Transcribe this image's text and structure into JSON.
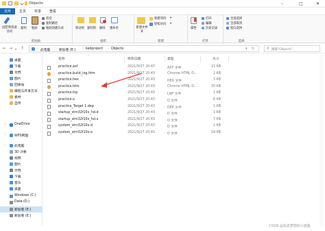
{
  "window": {
    "title": "Objects",
    "controls": {
      "minimize": "–",
      "maximize": "□",
      "close": "✕"
    }
  },
  "tabs": [
    "文件",
    "主页",
    "共享",
    "查看"
  ],
  "ribbon": {
    "clipboard": {
      "label": "剪贴板",
      "pin": "固定到快速访问",
      "copy": "复制",
      "paste": "粘贴",
      "cut": "剪切",
      "copy_path": "复制路径",
      "paste_shortcut": "粘贴快捷方式"
    },
    "organize": {
      "label": "组织",
      "move_to": "移动到",
      "copy_to": "复制到",
      "delete": "删除",
      "rename": "重命名"
    },
    "new": {
      "label": "新建",
      "new_item": "新建项目",
      "easy_access": "轻松访问",
      "new_folder": "新建文件夹"
    },
    "open": {
      "label": "打开",
      "properties": "属性",
      "open": "打开",
      "edit": "编辑",
      "history": "历史记录"
    },
    "select": {
      "label": "选择",
      "select_all": "全部选择",
      "select_none": "全部取消",
      "invert": "反向选择"
    }
  },
  "address": {
    "crumbs": [
      "此电脑",
      "新加卷 (E:)",
      "keilproject",
      "Objects"
    ],
    "search_placeholder": "搜索\"Objects\""
  },
  "sidebar": {
    "items": [
      {
        "label": "桌面",
        "color": "#4a90d9",
        "selected": false
      },
      {
        "label": "下载",
        "color": "#3b7fd0",
        "selected": false
      },
      {
        "label": "文档",
        "color": "#6f7f95",
        "selected": false
      },
      {
        "label": "图片",
        "color": "#4da3e0",
        "selected": false
      },
      {
        "label": "回收站",
        "color": "#8aa4bf",
        "selected": false
      },
      {
        "label": "编程与开发方法",
        "color": "#e5b94a",
        "selected": false
      },
      {
        "label": "素材",
        "color": "#e5b94a",
        "selected": false
      },
      {
        "label": "自传",
        "color": "#e5b94a",
        "selected": false
      },
      {
        "label": "OneDrive",
        "color": "#2d7de0",
        "selected": false
      },
      {
        "label": "WPS网盘",
        "color": "#3b8fe0",
        "selected": false
      },
      {
        "label": "此电脑",
        "color": "#4a90d9",
        "selected": false
      },
      {
        "label": "3D 对象",
        "color": "#7fa7d9",
        "selected": false
      },
      {
        "label": "视频",
        "color": "#6f7f95",
        "selected": false
      },
      {
        "label": "图片",
        "color": "#4da3e0",
        "selected": false
      },
      {
        "label": "文档",
        "color": "#6f7f95",
        "selected": false
      },
      {
        "label": "下载",
        "color": "#3b7fd0",
        "selected": false
      },
      {
        "label": "音乐",
        "color": "#3b9be0",
        "selected": false
      },
      {
        "label": "桌面",
        "color": "#4a90d9",
        "selected": false
      },
      {
        "label": "Windows (C:)",
        "color": "#6a8fb8",
        "selected": false
      },
      {
        "label": "Data (D:)",
        "color": "#8c8c8c",
        "selected": false
      },
      {
        "label": "新加卷 (E:)",
        "color": "#8c8c8c",
        "selected": true
      },
      {
        "label": "新加卷 (E:)",
        "color": "#8c8c8c",
        "selected": false
      }
    ]
  },
  "columns": {
    "name": "名称",
    "date": "修改日期",
    "type": "类型",
    "size": "大小"
  },
  "files": [
    {
      "name": "practice.axf",
      "date": "2021/9/27 20:43",
      "type": "AXF 文件",
      "size": "11 KB",
      "icon_color": "#ffffff"
    },
    {
      "name": "practice.build_log.htm",
      "date": "2021/9/27 20:43",
      "type": "Chrome HTML D...",
      "size": "2 KB",
      "icon_color": "#e8a23a"
    },
    {
      "name": "practice.hex",
      "date": "2021/9/27 20:43",
      "type": "HEX 文件",
      "size": "3 KB",
      "icon_color": "#ffffff"
    },
    {
      "name": "practice.htm",
      "date": "2021/9/27 20:43",
      "type": "Chrome HTML D...",
      "size": "30 KB",
      "icon_color": "#e8a23a"
    },
    {
      "name": "practice.lnp",
      "date": "2021/9/27 20:43",
      "type": "LNP 文件",
      "size": "1 KB",
      "icon_color": "#ffffff"
    },
    {
      "name": "practice.o",
      "date": "2021/9/27 20:43",
      "type": "O 文件",
      "size": "6 KB",
      "icon_color": "#ffffff"
    },
    {
      "name": "practice_Target 1.dep",
      "date": "2021/9/27 20:43",
      "type": "DEP 文件",
      "size": "1 KB",
      "icon_color": "#ffffff"
    },
    {
      "name": "startup_stm32f10x_hd.d",
      "date": "2021/9/27 20:43",
      "type": "D 文件",
      "size": "1 KB",
      "icon_color": "#ffffff"
    },
    {
      "name": "startup_stm32f10x_hd.o",
      "date": "2021/9/27 20:43",
      "type": "O 文件",
      "size": "7 KB",
      "icon_color": "#ffffff"
    },
    {
      "name": "system_stm32f10x.d",
      "date": "2021/9/27 20:43",
      "type": "D 文件",
      "size": "1 KB",
      "icon_color": "#ffffff"
    },
    {
      "name": "system_stm32f10x.o",
      "date": "2021/9/27 20:43",
      "type": "O 文件",
      "size": "18 KB",
      "icon_color": "#ffffff"
    }
  ],
  "watermark": "CSDN @失去梦想的小孤鱼",
  "annotation_arrow_color": "#e53935"
}
